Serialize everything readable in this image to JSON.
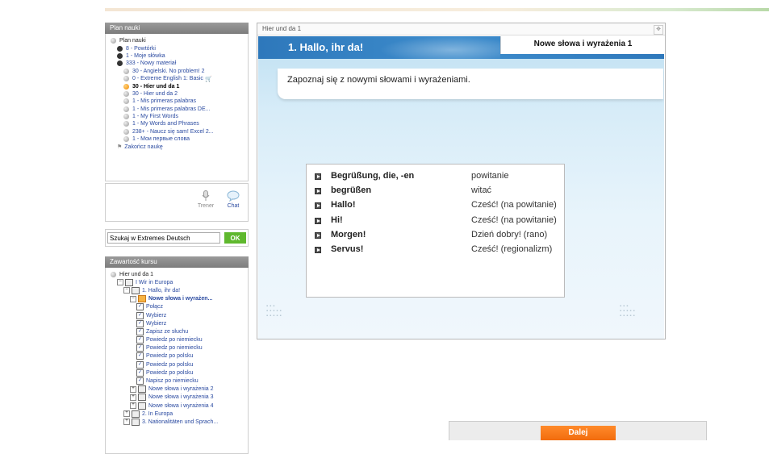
{
  "plan": {
    "header": "Plan nauki",
    "items": [
      {
        "label": "Plan nauki",
        "indent": 0,
        "icon": "dot",
        "style": "root"
      },
      {
        "label": "8 - Powtórki",
        "indent": 1,
        "icon": "dark"
      },
      {
        "label": "1 - Moje słówka",
        "indent": 1,
        "icon": "dark"
      },
      {
        "label": "333 - Nowy materiał",
        "indent": 1,
        "icon": "dark"
      },
      {
        "label": "30 - Angielski. No problem! 2",
        "indent": 2,
        "icon": "dot"
      },
      {
        "label": "0 - Extreme English 1: Basic",
        "indent": 2,
        "icon": "dot",
        "extra": "🛒"
      },
      {
        "label": "30 - Hier und da 1",
        "indent": 2,
        "icon": "orange",
        "style": "current"
      },
      {
        "label": "30 - Hier und da 2",
        "indent": 2,
        "icon": "dot"
      },
      {
        "label": "1 - Mis primeras palabras",
        "indent": 2,
        "icon": "dot"
      },
      {
        "label": "1 - Mis primeras palabras DE...",
        "indent": 2,
        "icon": "dot"
      },
      {
        "label": "1 - My First Words",
        "indent": 2,
        "icon": "dot"
      },
      {
        "label": "1 - My Words and Phrases",
        "indent": 2,
        "icon": "dot"
      },
      {
        "label": "238+ - Naucz się sam! Excel 2...",
        "indent": 2,
        "icon": "dot"
      },
      {
        "label": "1 - Мои первые слова",
        "indent": 2,
        "icon": "dot"
      },
      {
        "label": "Zakończ naukę",
        "indent": 1,
        "icon": "flag"
      }
    ]
  },
  "assistants": {
    "trener": "Trener",
    "chat": "Chat"
  },
  "search": {
    "value": "Szukaj w Extremes Deutsch",
    "ok": "OK"
  },
  "contents": {
    "header": "Zawartość kursu",
    "items": [
      {
        "label": "Hier und da 1",
        "indent": 0,
        "icon": "dot",
        "style": "root"
      },
      {
        "label": "I Wir in Europa",
        "indent": 1,
        "icon": "book",
        "pm": "−"
      },
      {
        "label": "1. Hallo, ihr da!",
        "indent": 2,
        "icon": "book",
        "pm": "−"
      },
      {
        "label": "Nowe słowa i wyrażen...",
        "indent": 3,
        "icon": "book-orange",
        "pm": "−",
        "style": "bold"
      },
      {
        "label": "Połącz",
        "indent": 4,
        "icon": "check"
      },
      {
        "label": "Wybierz",
        "indent": 4,
        "icon": "check"
      },
      {
        "label": "Wybierz",
        "indent": 4,
        "icon": "check"
      },
      {
        "label": "Zapisz ze słuchu",
        "indent": 4,
        "icon": "check"
      },
      {
        "label": "Powiedz po niemiecku",
        "indent": 4,
        "icon": "check"
      },
      {
        "label": "Powiedz po niemiecku",
        "indent": 4,
        "icon": "check"
      },
      {
        "label": "Powiedz po polsku",
        "indent": 4,
        "icon": "check"
      },
      {
        "label": "Powiedz po polsku",
        "indent": 4,
        "icon": "check"
      },
      {
        "label": "Powiedz po polsku",
        "indent": 4,
        "icon": "check"
      },
      {
        "label": "Napisz po niemiecku",
        "indent": 4,
        "icon": "check"
      },
      {
        "label": "Nowe słowa i wyrażenia 2",
        "indent": 3,
        "icon": "book",
        "pm": "+"
      },
      {
        "label": "Nowe słowa i wyrażenia 3",
        "indent": 3,
        "icon": "book",
        "pm": "+"
      },
      {
        "label": "Nowe słowa i wyrażenia 4",
        "indent": 3,
        "icon": "book",
        "pm": "+"
      },
      {
        "label": "2. In Europa",
        "indent": 2,
        "icon": "book",
        "pm": "+"
      },
      {
        "label": "3. Nationalitäten und Sprach...",
        "indent": 2,
        "icon": "book",
        "pm": "+"
      }
    ]
  },
  "frame": {
    "title": "Hier und da 1",
    "banner_title": "1. Hallo, ihr da!",
    "tab_label": "Nowe słowa i wyrażenia 1",
    "instruction": "Zapoznaj się z nowymi słowami i wyrażeniami."
  },
  "vocab": [
    {
      "de": "Begrüßung, die, -en",
      "pl": "powitanie"
    },
    {
      "de": "begrüßen",
      "pl": "witać"
    },
    {
      "de": "Hallo!",
      "pl": "Cześć! (na powitanie)"
    },
    {
      "de": "Hi!",
      "pl": "Cześć! (na powitanie)"
    },
    {
      "de": "Morgen!",
      "pl": "Dzień dobry! (rano)"
    },
    {
      "de": "Servus!",
      "pl": "Cześć! (regionalizm)"
    }
  ],
  "footer": {
    "next": "Dalej"
  }
}
